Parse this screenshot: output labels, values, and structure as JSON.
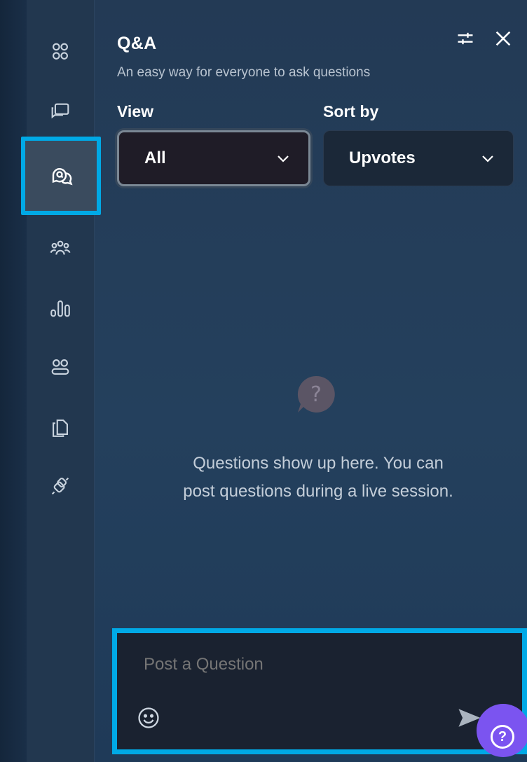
{
  "panel": {
    "title": "Q&A",
    "subtitle": "An easy way for everyone to ask questions"
  },
  "filters": {
    "view_label": "View",
    "view_value": "All",
    "sort_label": "Sort by",
    "sort_value": "Upvotes"
  },
  "empty_state": {
    "line1": "Questions show up here. You can",
    "line2": "post questions during a live session."
  },
  "composer": {
    "placeholder": "Post a Question"
  },
  "help": {
    "symbol": "?"
  },
  "sidebar": {
    "items": [
      "apps-icon",
      "chat-icon",
      "qa-icon",
      "people-icon",
      "polls-icon",
      "breakout-icon",
      "files-icon",
      "integrations-icon"
    ],
    "active": "qa-icon"
  },
  "colors": {
    "accent": "#00a9e6",
    "help_button": "#7b54f0",
    "panel_bg": "#24405d"
  }
}
